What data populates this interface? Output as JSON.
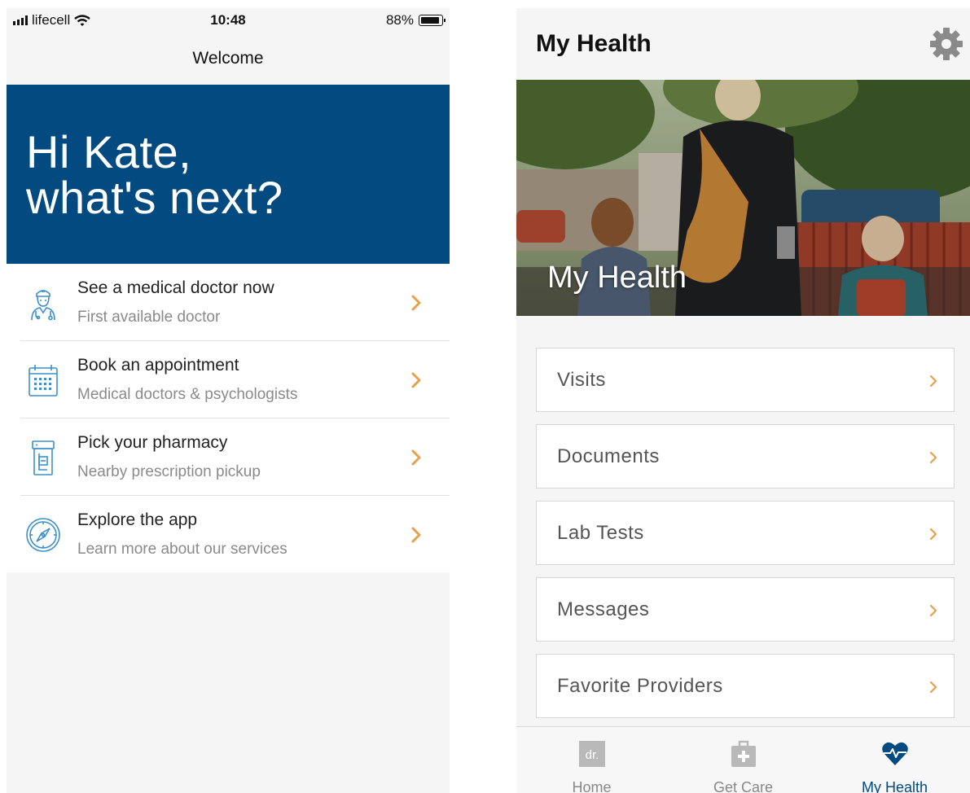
{
  "left_screen": {
    "status_bar": {
      "carrier": "lifecell",
      "time": "10:48",
      "battery": "88%"
    },
    "nav_title": "Welcome",
    "hero": {
      "line1": "Hi Kate,",
      "line2": "what's next?"
    },
    "menu_items": [
      {
        "title": "See a medical doctor now",
        "subtitle": "First available doctor",
        "icon": "doctor-icon"
      },
      {
        "title": "Book an appointment",
        "subtitle": "Medical doctors & psychologists",
        "icon": "calendar-icon"
      },
      {
        "title": "Pick your pharmacy",
        "subtitle": "Nearby prescription pickup",
        "icon": "pill-bottle-icon"
      },
      {
        "title": "Explore the app",
        "subtitle": "Learn more about our services",
        "icon": "compass-icon"
      }
    ]
  },
  "right_screen": {
    "title": "My Health",
    "settings_icon": "gear-icon",
    "banner_title": "My Health",
    "health_items": [
      "Visits",
      "Documents",
      "Lab Tests",
      "Messages",
      "Favorite Providers"
    ],
    "tabs": [
      {
        "label": "Home",
        "icon": "dr-logo-icon",
        "active": false
      },
      {
        "label": "Get Care",
        "icon": "medical-kit-icon",
        "active": false
      },
      {
        "label": "My Health",
        "icon": "heart-pulse-icon",
        "active": true
      }
    ]
  },
  "colors": {
    "brand_blue": "#034a80",
    "chevron_orange": "#e8a04c",
    "icon_blue": "#3d8fcc",
    "tab_inactive": "#888888"
  }
}
